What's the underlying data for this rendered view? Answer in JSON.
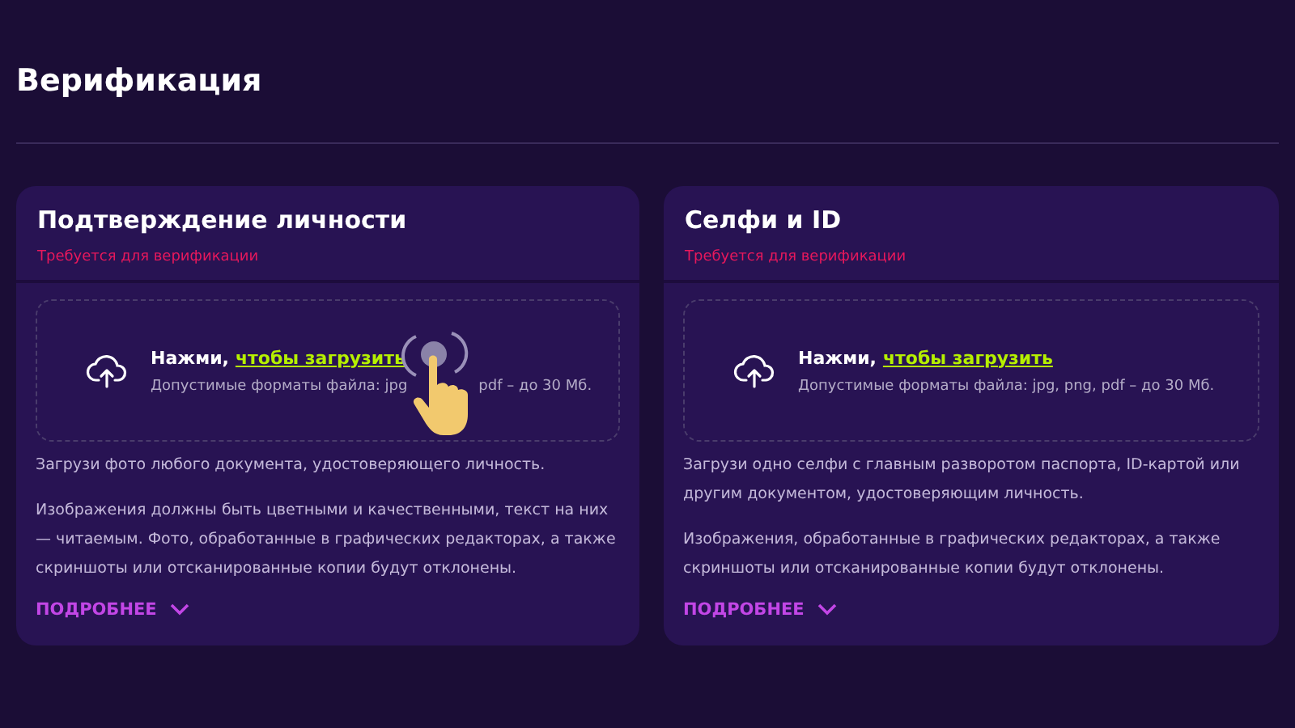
{
  "page": {
    "title": "Верификация"
  },
  "cards": [
    {
      "title": "Подтверждение личности",
      "subtitle": "Требуется для верификации",
      "upload": {
        "prompt": "Нажми,",
        "link": "чтобы загрузить",
        "hint_parts": [
          "Допустимые форматы файла: jpg",
          "pdf – до 30 Мб."
        ],
        "pointer": true
      },
      "paragraphs": [
        "Загрузи фото любого документа, удостоверяющего личность.",
        "Изображения должны быть цветными и качественными, текст на них — читаемым. Фото, обработанные в графических редакторах, а также скриншоты или отсканированные копии будут отклонены."
      ],
      "more": "ПОДРОБНЕЕ"
    },
    {
      "title": "Селфи и ID",
      "subtitle": "Требуется для верификации",
      "upload": {
        "prompt": "Нажми,",
        "link": "чтобы загрузить",
        "hint_parts": [
          "Допустимые форматы файла: jpg, png, pdf – до 30 Мб."
        ],
        "pointer": false
      },
      "paragraphs": [
        "Загрузи одно селфи с главным разворотом паспорта, ID-картой или другим документом, удостоверяющим личность.",
        "Изображения, обработанные в графических редакторах, а также скриншоты или отсканированные копии будут отклонены."
      ],
      "more": "ПОДРОБНЕЕ"
    }
  ]
}
